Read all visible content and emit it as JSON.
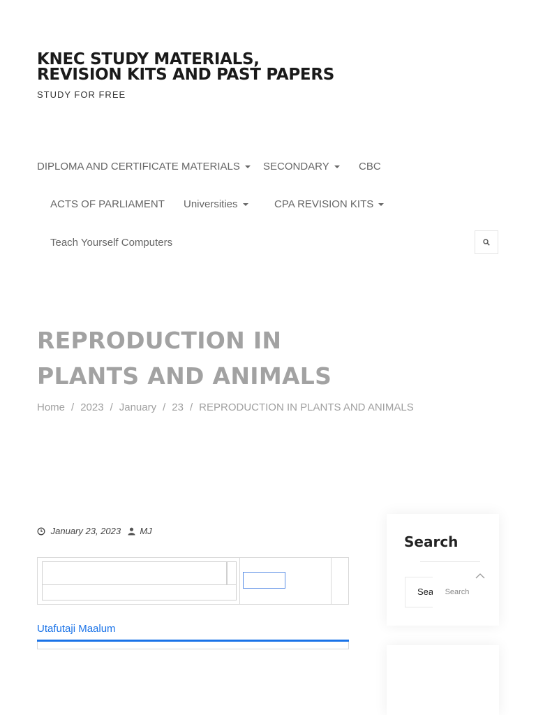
{
  "site": {
    "title": "KNEC STUDY MATERIALS, REVISION KITS AND PAST PAPERS",
    "tagline": "STUDY FOR FREE"
  },
  "nav": {
    "items": [
      {
        "label": "DIPLOMA AND CERTIFICATE MATERIALS",
        "has_dropdown": true
      },
      {
        "label": "SECONDARY",
        "has_dropdown": true
      },
      {
        "label": "CBC",
        "has_dropdown": false
      },
      {
        "label": "ACTS OF PARLIAMENT",
        "has_dropdown": false
      },
      {
        "label": "Universities",
        "has_dropdown": true
      },
      {
        "label": "CPA REVISION KITS",
        "has_dropdown": true
      },
      {
        "label": "Teach Yourself Computers",
        "has_dropdown": false
      }
    ],
    "search_icon": "search-icon"
  },
  "page": {
    "title": "REPRODUCTION IN PLANTS AND ANIMALS",
    "breadcrumb": [
      "Home",
      "2023",
      "January",
      "23",
      "REPRODUCTION IN PLANTS AND ANIMALS"
    ],
    "breadcrumb_separator": "/"
  },
  "post": {
    "date": "January 23, 2023",
    "author": "MJ",
    "date_icon": "clock-icon",
    "author_icon": "user-icon"
  },
  "custom_search": {
    "tab_label": "Utafutaji Maalum",
    "tab_color": "#1a73e8"
  },
  "sidebar": {
    "search_widget": {
      "title": "Search",
      "input_placeholder": "Search",
      "button_label": "Search"
    },
    "scroll_top_icon": "chevron-up-icon"
  },
  "colors": {
    "title": "#1a1a1a",
    "nav": "#666666",
    "page_title": "#a2a2a2",
    "link": "#1a73e8"
  }
}
